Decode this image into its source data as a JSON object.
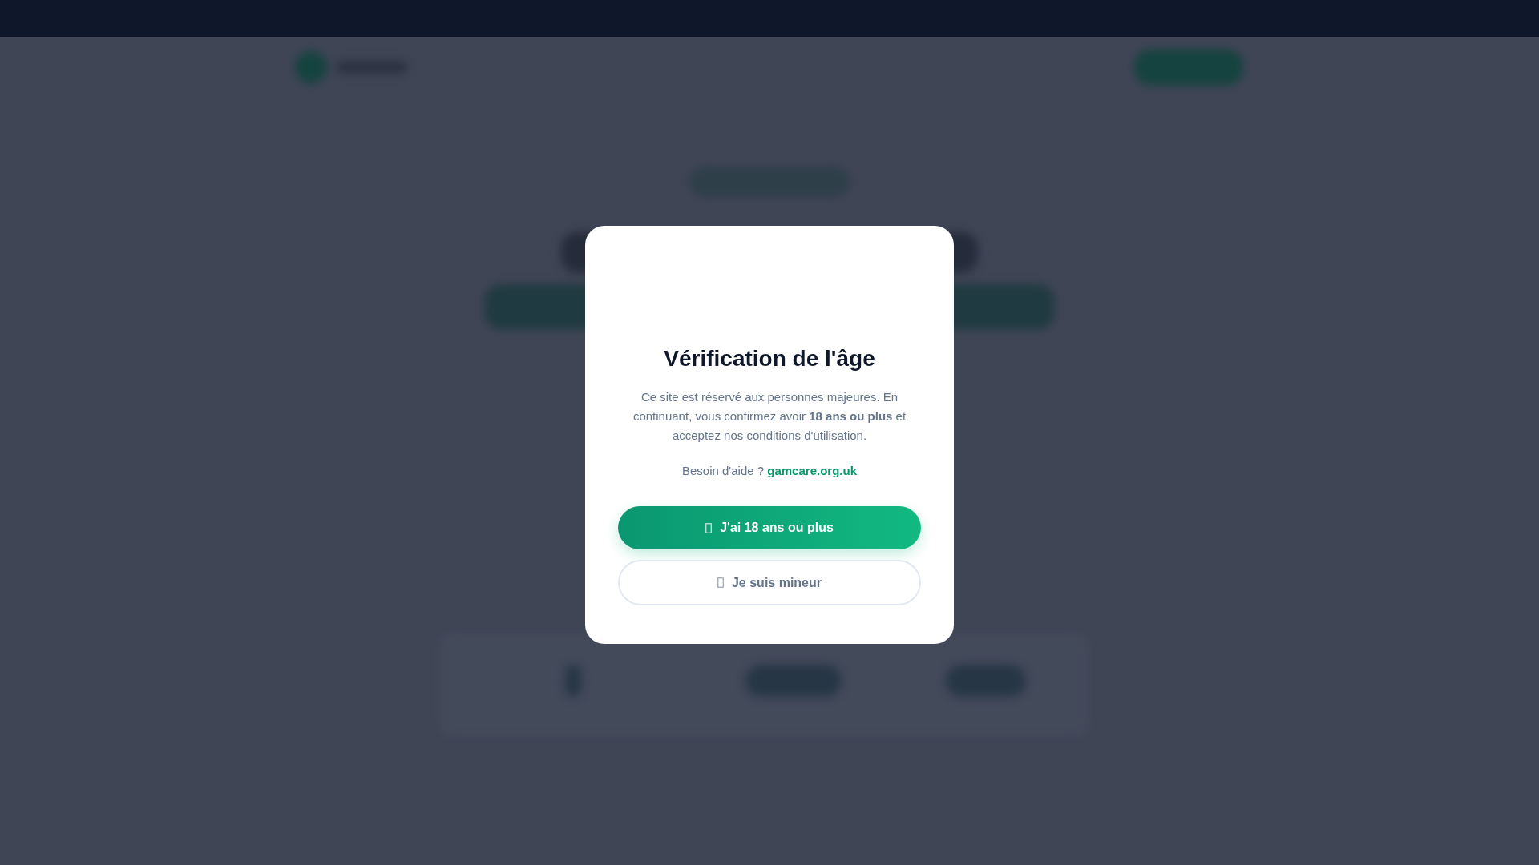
{
  "modal": {
    "title": "Vérification de l'âge",
    "message": "Ce site est réservé aux personnes majeures. En continuant, vous confirmez avoir **18 ans ou plus** et acceptez nos conditions d'utilisation.",
    "help_label": "Besoin d'aide ?",
    "help_link": "gamcare.org.uk",
    "buttons": [
      {
        "kind": "primary",
        "label": "J'ai 18 ans ou plus"
      },
      {
        "kind": "secondary",
        "label": "Je suis mineur"
      }
    ]
  }
}
